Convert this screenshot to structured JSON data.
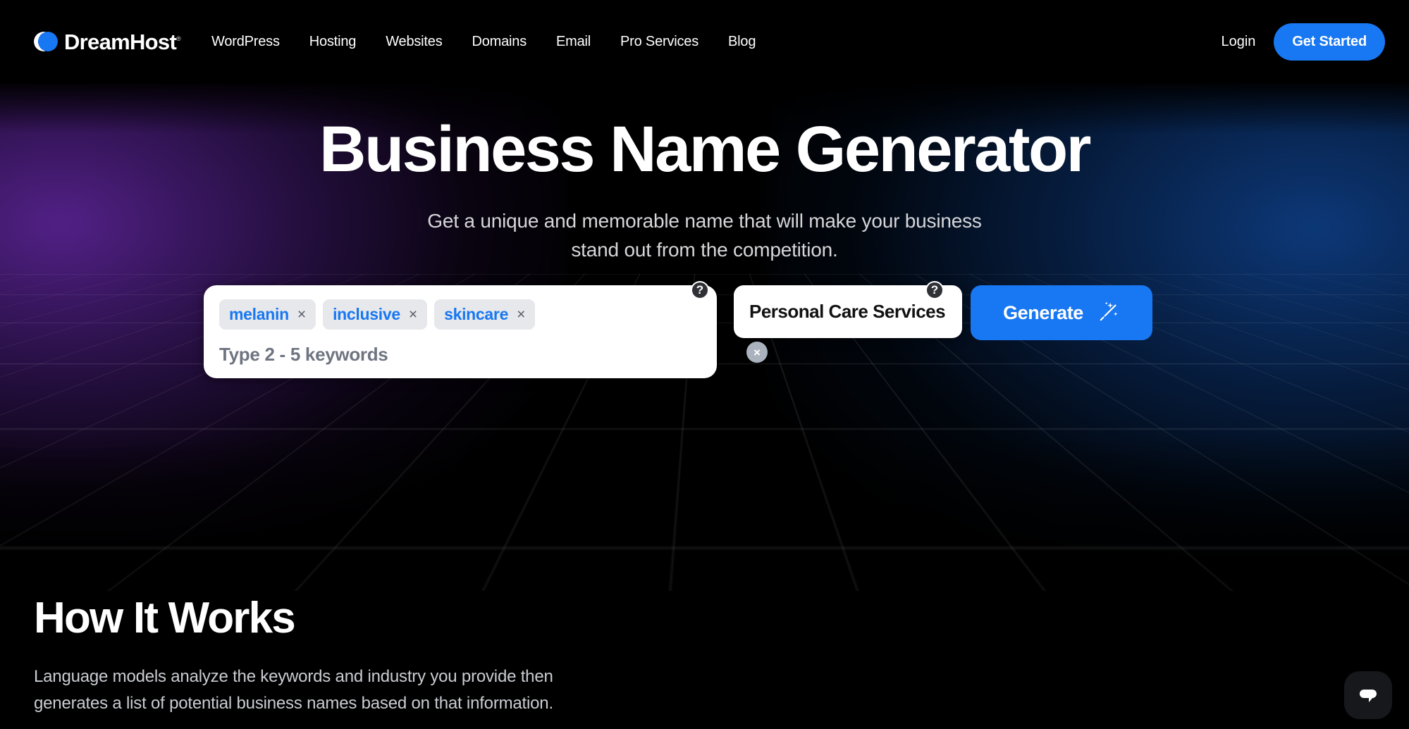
{
  "brand": {
    "name": "DreamHost",
    "trademark": "®",
    "logo_icon": "dreamhost-crescent-logo",
    "accent_color": "#1877F2"
  },
  "nav": {
    "links": [
      {
        "label": "WordPress"
      },
      {
        "label": "Hosting"
      },
      {
        "label": "Websites"
      },
      {
        "label": "Domains"
      },
      {
        "label": "Email"
      },
      {
        "label": "Pro Services"
      },
      {
        "label": "Blog"
      }
    ],
    "login_label": "Login",
    "cta_label": "Get Started"
  },
  "hero": {
    "title": "Business Name Generator",
    "subtitle_line1": "Get a unique and memorable name that will make your business",
    "subtitle_line2": "stand out from the competition."
  },
  "form": {
    "keywords": [
      {
        "label": "melanin",
        "remove": "×"
      },
      {
        "label": "inclusive",
        "remove": "×"
      },
      {
        "label": "skincare",
        "remove": "×"
      }
    ],
    "keyword_placeholder": "Type 2 - 5 keywords",
    "keyword_help_icon": "question-mark-icon",
    "keyword_help_label": "?",
    "industry_value": "Personal Care Services",
    "industry_help_icon": "question-mark-icon",
    "industry_help_label": "?",
    "clear_label": "×",
    "clear_icon": "close-x-icon",
    "generate_label": "Generate",
    "generate_icon": "magic-wand-icon",
    "chip_text_color": "#1877F2",
    "button_color": "#1877F2"
  },
  "how_it_works": {
    "title": "How It Works",
    "body_line1": "Language models analyze the keywords and industry you provide then",
    "body_line2": "generates a list of potential business names based on that information."
  },
  "chat": {
    "icon": "chat-bubble-icon",
    "aria_label": "Open chat"
  }
}
